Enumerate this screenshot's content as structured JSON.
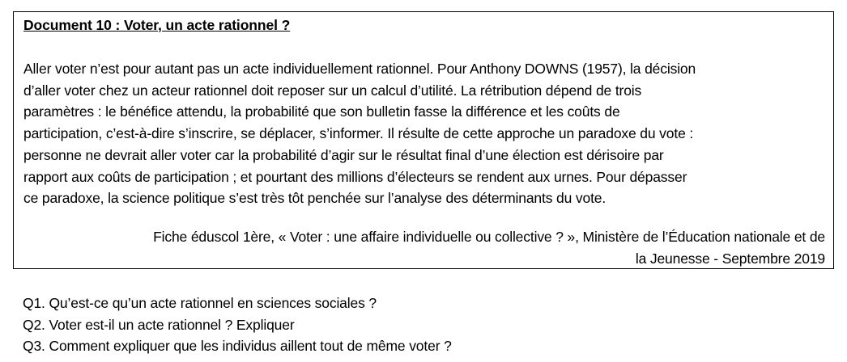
{
  "document": {
    "title": "Document 10 : Voter, un acte rationnel ?",
    "body_lines": [
      "Aller voter n’est pour autant pas un acte individuellement rationnel. Pour Anthony DOWNS (1957), la décision",
      "d’aller voter chez un acteur rationnel doit reposer sur un calcul d’utilité. La rétribution dépend de trois",
      "paramètres : le bénéfice attendu, la probabilité que son bulletin fasse la différence et les coûts de",
      "participation, c’est-à-dire s’inscrire, se déplacer, s’informer.  Il résulte de cette approche un paradoxe du vote :",
      "personne ne devrait aller voter car la probabilité d’agir sur le résultat final d’une élection est dérisoire par",
      "rapport aux coûts de participation ; et pourtant des millions d’électeurs se rendent aux urnes. Pour dépasser",
      "ce paradoxe, la science politique s’est très tôt penchée sur l’analyse des déterminants du vote."
    ],
    "source_lines": [
      "Fiche éduscol 1ère, « Voter : une affaire individuelle ou collective ? », Ministère de l’Éducation nationale et de",
      "la Jeunesse - Septembre 2019"
    ]
  },
  "questions": [
    "Q1. Qu’est-ce qu’un acte rationnel en sciences sociales ?",
    "Q2. Voter est-il un acte rationnel ? Expliquer",
    "Q3. Comment expliquer que les individus aillent tout de même voter ?"
  ]
}
